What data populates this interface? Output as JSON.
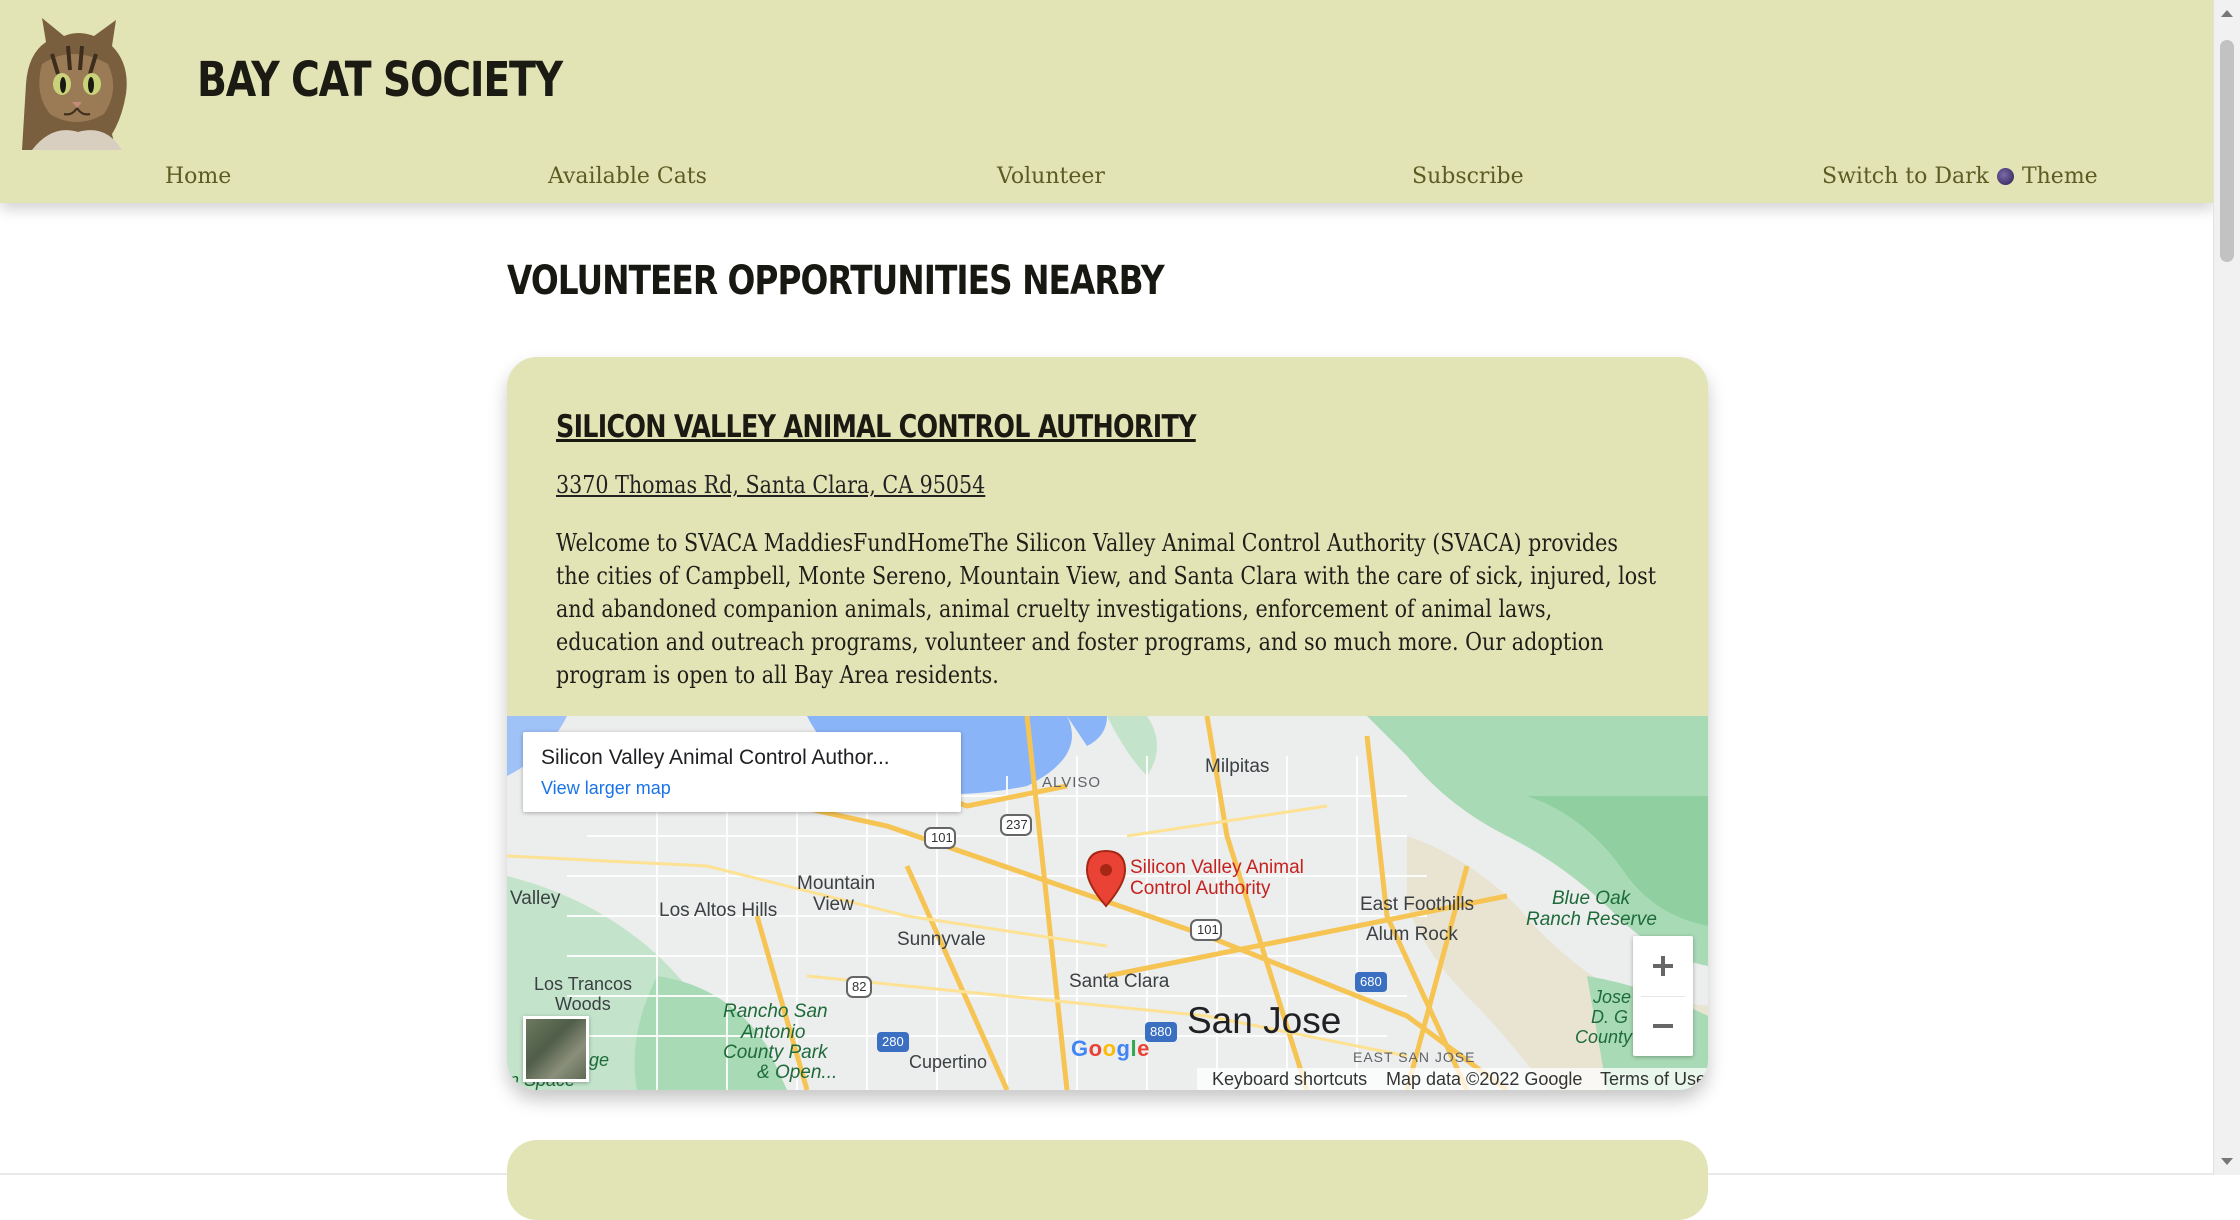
{
  "header": {
    "site_title": "BAY CAT SOCIETY",
    "logo_icon": "cat-face-logo",
    "nav": {
      "home": "Home",
      "available_cats": "Available Cats",
      "volunteer": "Volunteer",
      "subscribe": "Subscribe",
      "theme_prefix": "Switch to Dark",
      "theme_suffix": "Theme"
    }
  },
  "main": {
    "heading": "VOLUNTEER OPPORTUNITIES NEARBY",
    "cards": [
      {
        "title": "SILICON VALLEY ANIMAL CONTROL AUTHORITY",
        "address": "3370 Thomas Rd, Santa Clara, CA 95054",
        "description": "Welcome to SVACA MaddiesFundHomeThe Silicon Valley Animal Control Authority (SVACA) provides the cities of Campbell, Monte Sereno, Mountain View, and Santa Clara with the care of sick, injured, lost and abandoned companion animals, animal cruelty investigations, enforcement of animal laws, education and outreach programs, volunteer and foster programs, and so much more. Our adoption program is open to all Bay Area residents.",
        "map": {
          "info_title": "Silicon Valley Animal Control Author...",
          "info_link": "View larger map",
          "pin_label_1": "Silicon Valley Animal",
          "pin_label_2": "Control Authority",
          "labels": {
            "alviso": "ALVISO",
            "milpitas": "Milpitas",
            "mountain_view_1": "Mountain",
            "mountain_view_2": "View",
            "valley": "Valley",
            "los_altos_hills": "Los Altos Hills",
            "sunnyvale": "Sunnyvale",
            "santa_clara": "Santa Clara",
            "san_jose": "San Jose",
            "east_foothills": "East Foothills",
            "alum_rock": "Alum Rock",
            "blue_oak_1": "Blue Oak",
            "blue_oak_2": "Ranch Reserve",
            "los_trancos_1": "Los Trancos",
            "los_trancos_2": "Woods",
            "rancho_1": "Rancho San",
            "rancho_2": "Antonio",
            "rancho_3": "County Park",
            "rancho_4": "& Open...",
            "cupertino": "Cupertino",
            "east_san_jose": "EAST SAN JOSE",
            "jose_1": "Jose",
            "jose_2": "D. G",
            "jose_3": "County",
            "ge": "ge",
            "n_space": "n Space",
            "hwy_101_a": "101",
            "hwy_101_b": "101",
            "hwy_237": "237",
            "hwy_82": "82",
            "hwy_280": "280",
            "hwy_880": "880",
            "hwy_680": "680"
          },
          "google": "Google",
          "footer": {
            "shortcuts": "Keyboard shortcuts",
            "data": "Map data ©2022 Google",
            "terms": "Terms of Use"
          },
          "zoom_in_icon": "plus-icon",
          "zoom_out_icon": "minus-icon"
        }
      }
    ]
  }
}
